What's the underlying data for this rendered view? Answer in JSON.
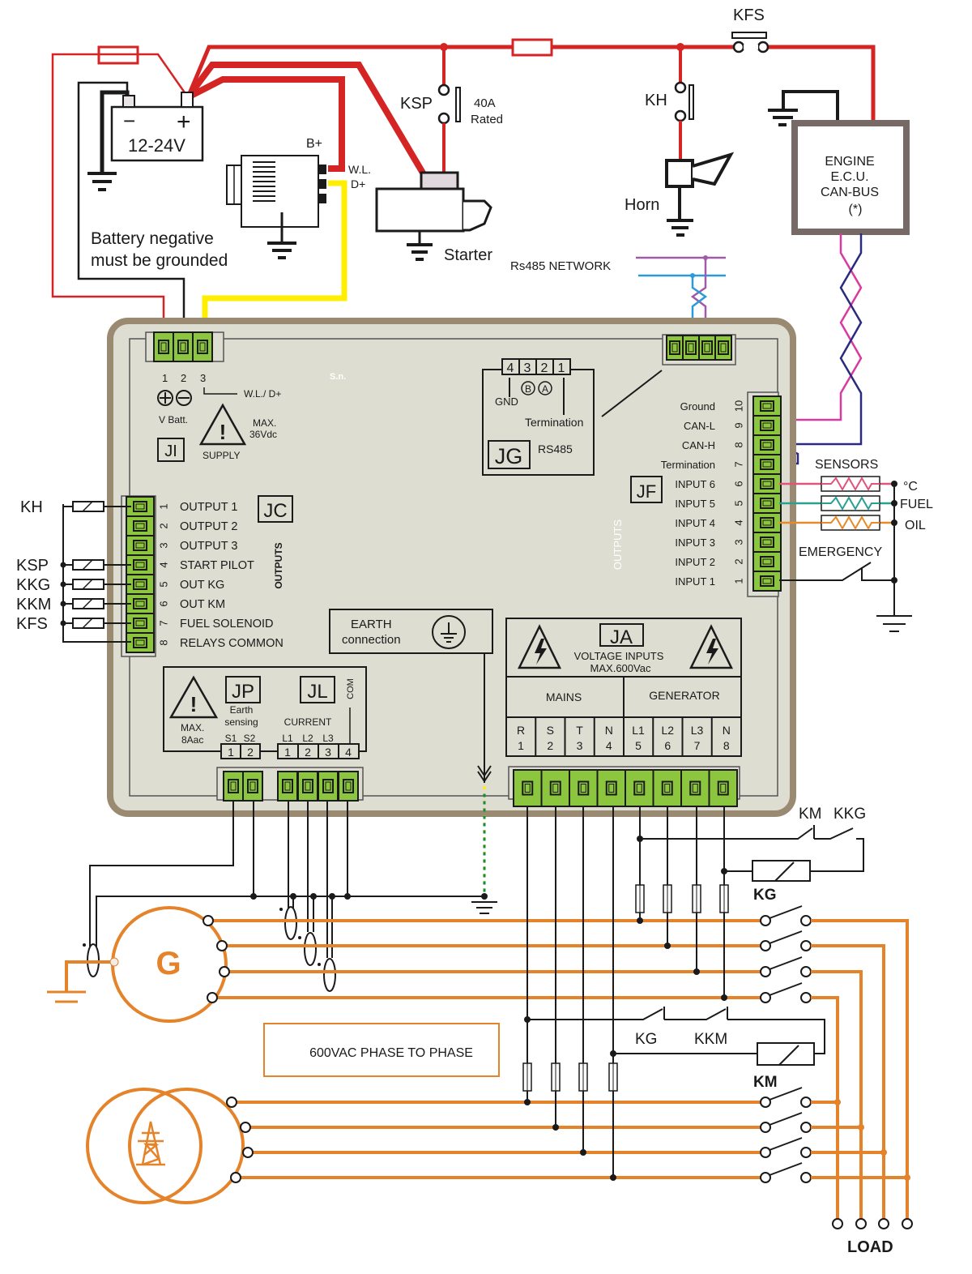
{
  "colors": {
    "power_wire": "#d42424",
    "signal_wire": "#1a1a1a",
    "ac_wire": "#e4832a",
    "dplus_wire": "#ffee00",
    "terminal": "#8cc63f",
    "panel_face": "#deddd1",
    "panel_bezel": "#9a8a72",
    "can_l": "#d93aa0",
    "can_h": "#2a2a80",
    "rs485_a": "#a05aa8",
    "rs485_b": "#2b9ad8",
    "sensor_temp": "#e0557a",
    "sensor_fuel": "#2aa090",
    "sensor_oil": "#e88a2a"
  },
  "top": {
    "battery_minus": "−",
    "battery_plus": "+",
    "battery_voltage": "12-24V",
    "alternator_bplus": "B+",
    "alternator_wl": "W.L.",
    "alternator_dplus": "D+",
    "battery_note_line1": "Battery negative",
    "battery_note_line2": "must  be grounded",
    "ksp_label": "KSP",
    "ksp_rating_line1": "40A",
    "ksp_rating_line2": "Rated",
    "starter_label": "Starter",
    "kh_label": "KH",
    "horn_label": "Horn",
    "kfs_label": "KFS",
    "ecu_line1": "ENGINE",
    "ecu_line2": "E.C.U.",
    "ecu_line3": "CAN-BUS",
    "ecu_line4": "(*)",
    "rs485_network": "Rs485 NETWORK"
  },
  "ji": {
    "pins": [
      "1",
      "2",
      "3"
    ],
    "wl_dplus": "W.L./ D+",
    "vbatt": "V Batt.",
    "max": "MAX.",
    "max_value": "36Vdc",
    "supply": "SUPPLY",
    "code": "JI",
    "serial": "S.n."
  },
  "jg": {
    "pins": [
      "4",
      "3",
      "2",
      "1"
    ],
    "b": "B",
    "a": "A",
    "gnd": "GND",
    "termination": "Termination",
    "code": "JG",
    "name": "RS485"
  },
  "jf": {
    "code": "JF",
    "rows": [
      {
        "num": "10",
        "label": "Ground"
      },
      {
        "num": "9",
        "label": "CAN-L"
      },
      {
        "num": "8",
        "label": "CAN-H"
      },
      {
        "num": "7",
        "label": "Termination"
      },
      {
        "num": "6",
        "label": "INPUT 6"
      },
      {
        "num": "5",
        "label": "INPUT 5"
      },
      {
        "num": "4",
        "label": "INPUT 4"
      },
      {
        "num": "3",
        "label": "INPUT 3"
      },
      {
        "num": "2",
        "label": "INPUT 2"
      },
      {
        "num": "1",
        "label": "INPUT 1"
      }
    ],
    "watermark": "OUTPUTS",
    "sensors_title": "SENSORS",
    "sensor_temp": "°C",
    "sensor_fuel": "FUEL",
    "sensor_oil": "OIL",
    "emergency": "EMERGENCY"
  },
  "jc": {
    "code": "JC",
    "side_label": "OUTPUTS",
    "rows": [
      {
        "num": "1",
        "label": "OUTPUT 1"
      },
      {
        "num": "2",
        "label": "OUTPUT 2"
      },
      {
        "num": "3",
        "label": "OUTPUT 3"
      },
      {
        "num": "4",
        "label": "START PILOT"
      },
      {
        "num": "5",
        "label": "OUT KG"
      },
      {
        "num": "6",
        "label": "OUT KM"
      },
      {
        "num": "7",
        "label": "FUEL SOLENOID"
      },
      {
        "num": "8",
        "label": "RELAYS COMMON"
      }
    ],
    "relays": [
      "KH",
      "KSP",
      "KKG",
      "KKM",
      "KFS"
    ]
  },
  "earth": {
    "line1": "EARTH",
    "line2": "connection"
  },
  "jp_jl": {
    "max": "MAX.",
    "max_value": "8Aac",
    "jp_code": "JP",
    "jp_line1": "Earth",
    "jp_line2": "sensing",
    "jp_pins_top": [
      "S1",
      "S2"
    ],
    "jp_pins": [
      "1",
      "2"
    ],
    "jl_code": "JL",
    "jl_title": "CURRENT",
    "com": "COM",
    "jl_pins_top": [
      "L1",
      "L2",
      "L3"
    ],
    "jl_pins": [
      "1",
      "2",
      "3",
      "4"
    ]
  },
  "ja": {
    "code": "JA",
    "line1": "VOLTAGE INPUTS",
    "line2": "MAX.600Vac",
    "mains": "MAINS",
    "generator": "GENERATOR",
    "cols": [
      {
        "top": "R",
        "num": "1"
      },
      {
        "top": "S",
        "num": "2"
      },
      {
        "top": "T",
        "num": "3"
      },
      {
        "top": "N",
        "num": "4"
      },
      {
        "top": "L1",
        "num": "5"
      },
      {
        "top": "L2",
        "num": "6"
      },
      {
        "top": "L3",
        "num": "7"
      },
      {
        "top": "N",
        "num": "8"
      }
    ]
  },
  "bottom": {
    "km_contact": "KM",
    "kkg_contact": "KKG",
    "kg_coil": "KG",
    "kg_contact": "KG",
    "kkm_contact": "KKM",
    "km_coil": "KM",
    "generator": "G",
    "phase_note": "600VAC PHASE TO PHASE",
    "load": "LOAD"
  }
}
